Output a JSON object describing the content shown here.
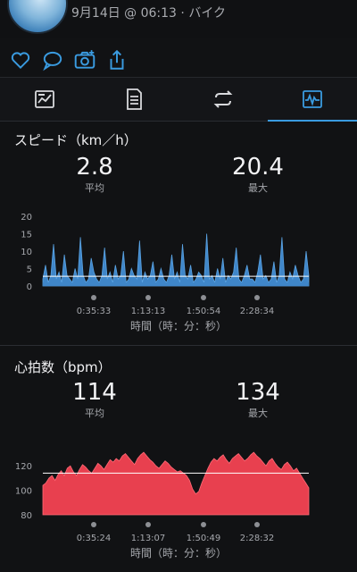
{
  "header": {
    "activity_meta": "9月14日 @ 06:13 · バイク"
  },
  "actions": [
    {
      "name": "like-icon"
    },
    {
      "name": "comment-icon"
    },
    {
      "name": "camera-add-icon"
    },
    {
      "name": "share-icon"
    }
  ],
  "tabs": [
    {
      "name": "tab-summary",
      "icon": "summary-icon"
    },
    {
      "name": "tab-details",
      "icon": "details-icon"
    },
    {
      "name": "tab-laps",
      "icon": "laps-icon"
    },
    {
      "name": "tab-charts",
      "icon": "chart-icon",
      "active": true
    }
  ],
  "speed": {
    "title": "スピード（km／h）",
    "avg_value": "2.8",
    "avg_label": "平均",
    "max_value": "20.4",
    "max_label": "最大",
    "axis_note": "時間（時：分：秒）"
  },
  "heart": {
    "title": "心拍数（bpm）",
    "avg_value": "114",
    "avg_label": "平均",
    "max_value": "134",
    "max_label": "最大",
    "axis_note": "時間（時：分：秒）"
  },
  "colors": {
    "accent": "#3a9be0",
    "speed_fill": "#3f86c9",
    "hr_fill": "#e8404f"
  },
  "chart_data": [
    {
      "type": "area",
      "title": "スピード（km／h）",
      "ylim": [
        0,
        20
      ],
      "yticks": [
        "20",
        "15",
        "10",
        "5",
        "0"
      ],
      "xticks": [
        "0:35:33",
        "1:13:13",
        "1:50:54",
        "2:28:34"
      ],
      "avg_line": 2.8,
      "series": [
        {
          "values": [
            2,
            6,
            1,
            3,
            12,
            2,
            4,
            1,
            9,
            3,
            2,
            1,
            5,
            2,
            14,
            3,
            1,
            2,
            8,
            4,
            2,
            1,
            3,
            11,
            2,
            4,
            1,
            6,
            2,
            3,
            10,
            1,
            2,
            5,
            3,
            2,
            13,
            1,
            4,
            2,
            3,
            7,
            1,
            2,
            5,
            2,
            1,
            3,
            9,
            2,
            4,
            1,
            12,
            3,
            2,
            6,
            1,
            2,
            4,
            3,
            1,
            15,
            2,
            3,
            1,
            5,
            2,
            8,
            1,
            3,
            2,
            4,
            11,
            2,
            1,
            3,
            6,
            2,
            2,
            1,
            4,
            9,
            2,
            3,
            1,
            2,
            7,
            1,
            3,
            14,
            2,
            1,
            4,
            2,
            6,
            3,
            1,
            2,
            10,
            3
          ]
        }
      ]
    },
    {
      "type": "area",
      "title": "心拍数（bpm）",
      "ylim": [
        80,
        134
      ],
      "yticks": [
        "120",
        "100",
        "80"
      ],
      "xticks": [
        "0:35:24",
        "1:13:07",
        "1:50:49",
        "2:28:32"
      ],
      "avg_line": 114,
      "series": [
        {
          "values": [
            104,
            106,
            110,
            112,
            108,
            113,
            116,
            112,
            118,
            120,
            115,
            112,
            117,
            121,
            119,
            116,
            114,
            118,
            122,
            120,
            117,
            121,
            125,
            123,
            126,
            124,
            128,
            130,
            127,
            124,
            121,
            126,
            129,
            131,
            128,
            125,
            123,
            120,
            118,
            121,
            124,
            122,
            119,
            117,
            115,
            116,
            114,
            112,
            108,
            101,
            97,
            99,
            106,
            112,
            118,
            123,
            126,
            124,
            127,
            129,
            125,
            122,
            126,
            128,
            130,
            127,
            124,
            126,
            129,
            131,
            128,
            126,
            123,
            120,
            124,
            126,
            122,
            119,
            117,
            121,
            123,
            120,
            116,
            118,
            114,
            110,
            106,
            102
          ]
        }
      ]
    }
  ]
}
